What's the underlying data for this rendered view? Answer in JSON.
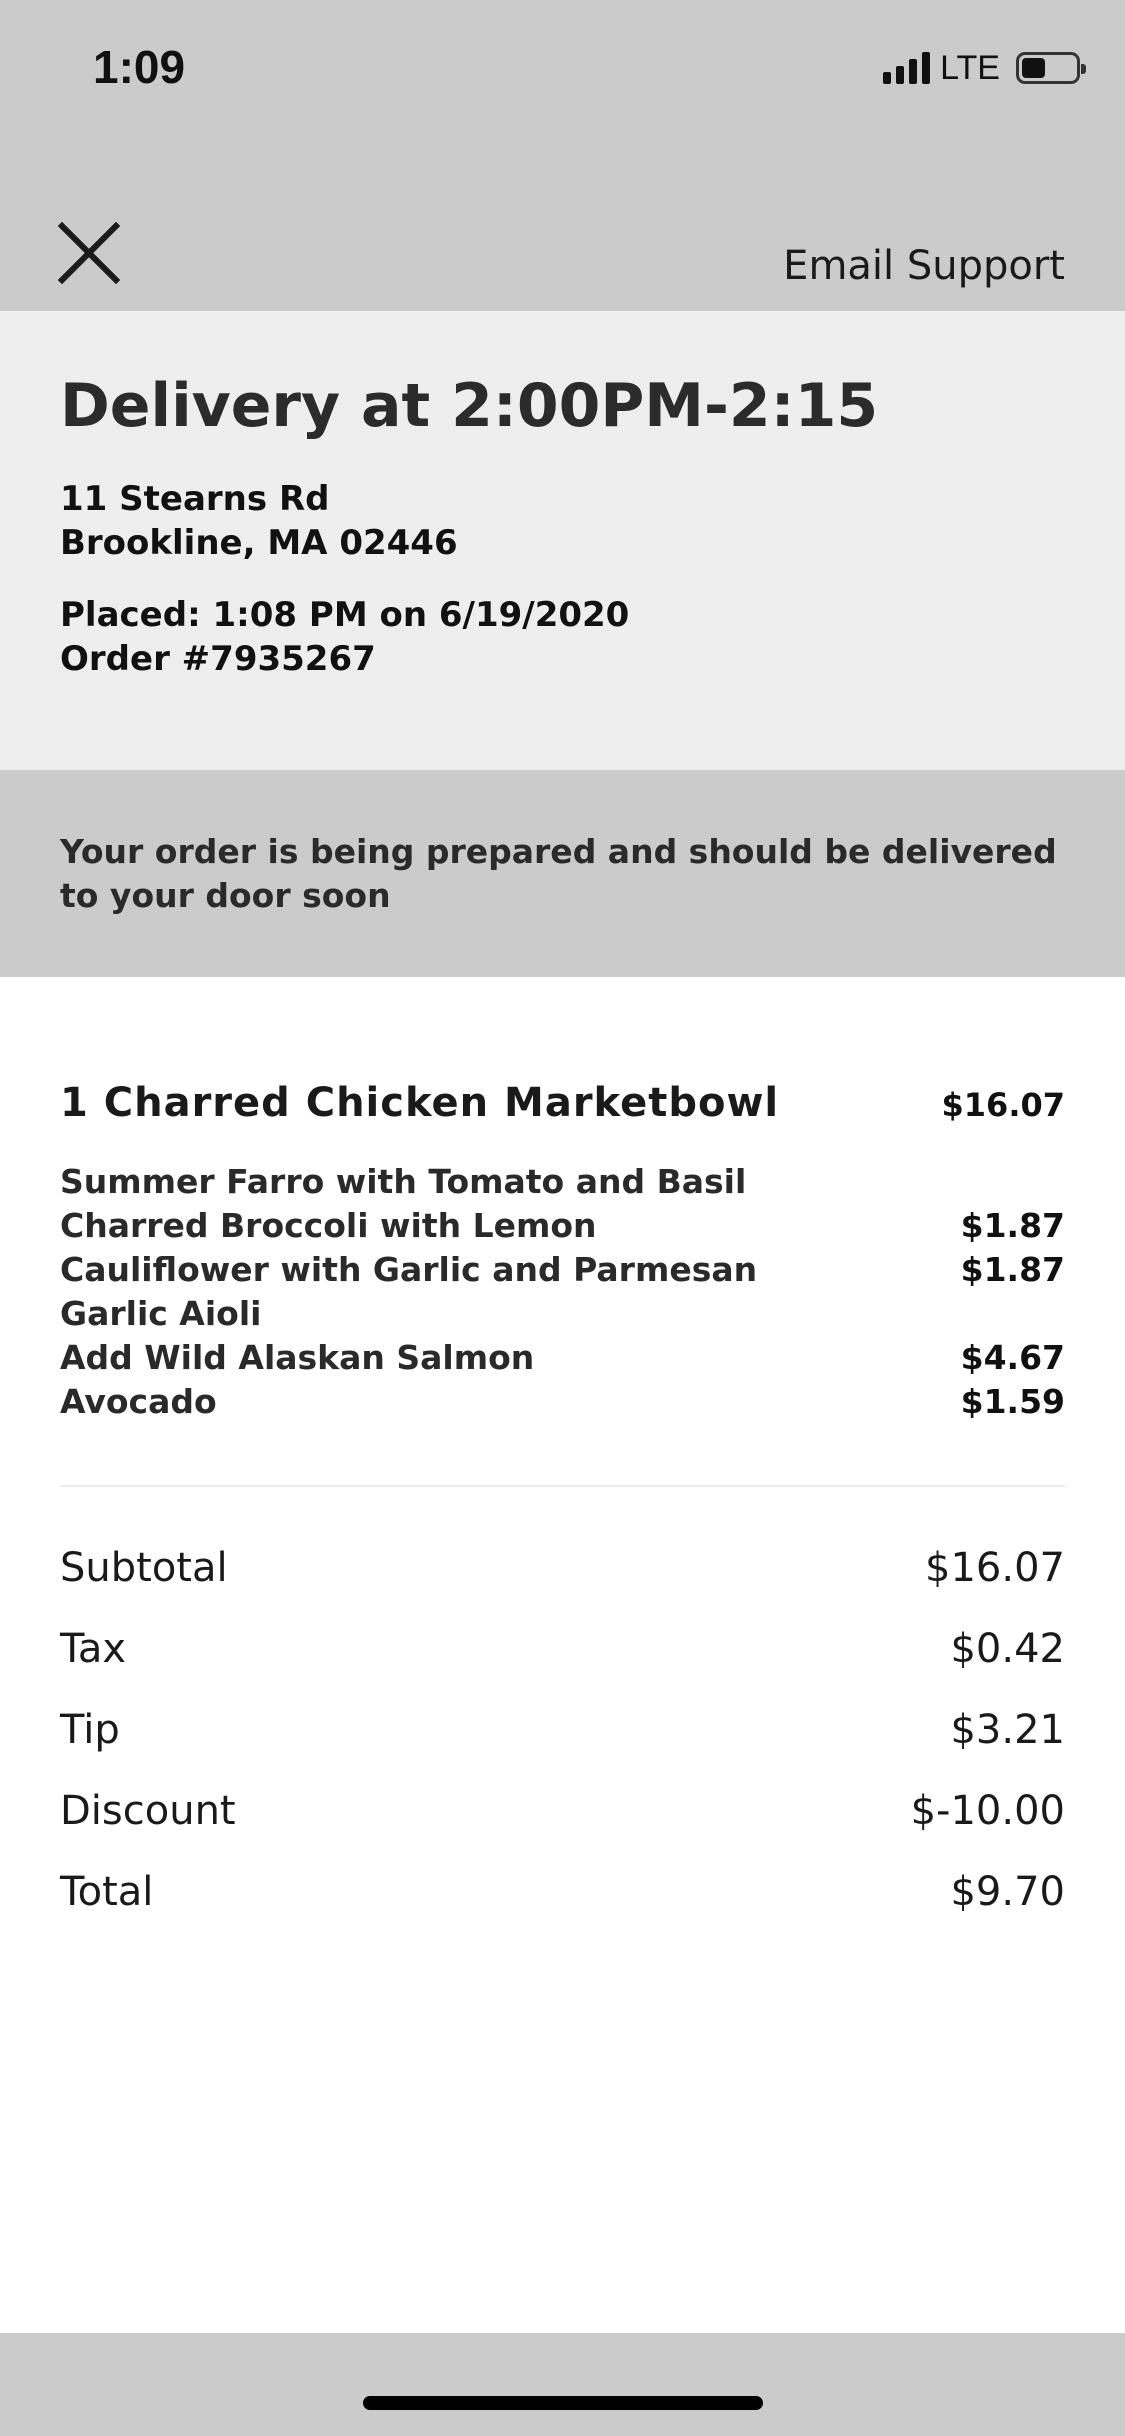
{
  "status_bar": {
    "time": "1:09",
    "network": "LTE",
    "signal_bars": 4,
    "battery_level": 0.45
  },
  "nav": {
    "close_icon": "close-icon",
    "email_support_label": "Email Support"
  },
  "delivery": {
    "title": "Delivery at 2:00PM-2:15",
    "address_line1": "11 Stearns Rd",
    "address_line2": "Brookline, MA 02446",
    "placed": "Placed: 1:08 PM on 6/19/2020",
    "order_number": "Order #7935267"
  },
  "status_message": "Your order is being prepared and should be delivered to your door soon",
  "item": {
    "name": "1 Charred Chicken Marketbowl",
    "price": "$16.07",
    "modifiers": [
      {
        "name": "Summer Farro with Tomato and Basil",
        "price": ""
      },
      {
        "name": "Charred Broccoli with Lemon",
        "price": "$1.87"
      },
      {
        "name": "Cauliflower with Garlic and Parmesan",
        "price": "$1.87"
      },
      {
        "name": "Garlic Aioli",
        "price": ""
      },
      {
        "name": "Add Wild Alaskan Salmon",
        "price": "$4.67"
      },
      {
        "name": "Avocado",
        "price": "$1.59"
      }
    ]
  },
  "totals": [
    {
      "label": "Subtotal",
      "value": "$16.07"
    },
    {
      "label": "Tax",
      "value": "$0.42"
    },
    {
      "label": "Tip",
      "value": "$3.21"
    },
    {
      "label": "Discount",
      "value": "$-10.00"
    },
    {
      "label": "Total",
      "value": "$9.70"
    }
  ],
  "colors": {
    "topbar": "#cbcbcb",
    "panel": "#eeeeee",
    "text": "#1c1c1c"
  }
}
